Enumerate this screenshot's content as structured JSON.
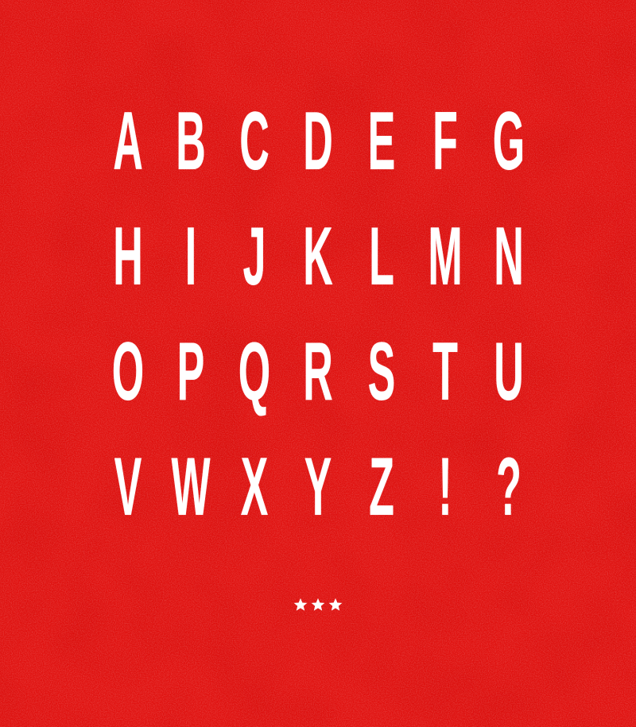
{
  "colors": {
    "background": "#e0110f",
    "glyph": "#ffffff"
  },
  "rows": [
    [
      "A",
      "B",
      "C",
      "D",
      "E",
      "F",
      "G"
    ],
    [
      "H",
      "I",
      "J",
      "K",
      "L",
      "M",
      "N"
    ],
    [
      "O",
      "P",
      "Q",
      "R",
      "S",
      "T",
      "U"
    ],
    [
      "V",
      "W",
      "X",
      "Y",
      "Z",
      "!",
      "?"
    ]
  ],
  "ornament": {
    "icon": "star-icon",
    "count": 3
  }
}
